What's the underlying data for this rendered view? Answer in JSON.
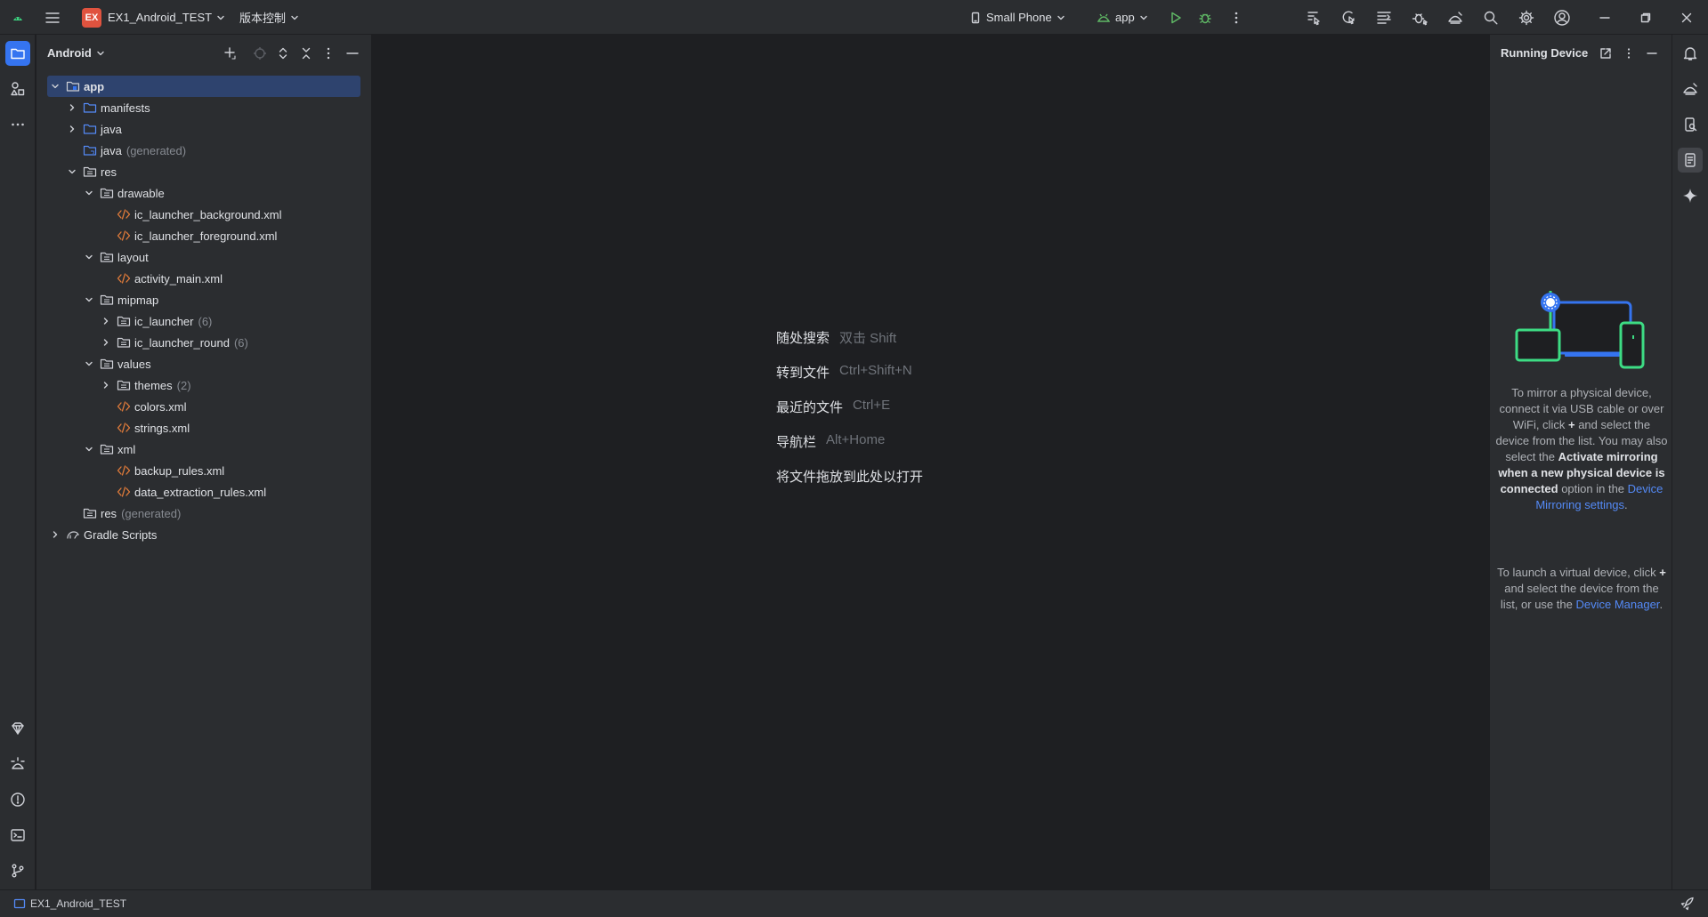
{
  "titlebar": {
    "project_badge": "EX",
    "project_name": "EX1_Android_TEST",
    "vcs_label": "版本控制",
    "device_label": "Small Phone",
    "run_config": "app"
  },
  "project_panel": {
    "view_label": "Android",
    "tree": [
      {
        "label": "app",
        "hint": "",
        "selected": true
      },
      {
        "label": "manifests",
        "hint": ""
      },
      {
        "label": "java",
        "hint": ""
      },
      {
        "label": "java",
        "hint": "(generated)"
      },
      {
        "label": "res",
        "hint": ""
      },
      {
        "label": "drawable",
        "hint": ""
      },
      {
        "label": "ic_launcher_background.xml",
        "hint": ""
      },
      {
        "label": "ic_launcher_foreground.xml",
        "hint": ""
      },
      {
        "label": "layout",
        "hint": ""
      },
      {
        "label": "activity_main.xml",
        "hint": ""
      },
      {
        "label": "mipmap",
        "hint": ""
      },
      {
        "label": "ic_launcher",
        "hint": "(6)"
      },
      {
        "label": "ic_launcher_round",
        "hint": "(6)"
      },
      {
        "label": "values",
        "hint": ""
      },
      {
        "label": "themes",
        "hint": "(2)"
      },
      {
        "label": "colors.xml",
        "hint": ""
      },
      {
        "label": "strings.xml",
        "hint": ""
      },
      {
        "label": "xml",
        "hint": ""
      },
      {
        "label": "backup_rules.xml",
        "hint": ""
      },
      {
        "label": "data_extraction_rules.xml",
        "hint": ""
      },
      {
        "label": "res",
        "hint": "(generated)"
      },
      {
        "label": "Gradle Scripts",
        "hint": ""
      }
    ]
  },
  "editor": {
    "empty_state": [
      {
        "label": "随处搜索",
        "shortcut": "双击 Shift"
      },
      {
        "label": "转到文件",
        "shortcut": "Ctrl+Shift+N"
      },
      {
        "label": "最近的文件",
        "shortcut": "Ctrl+E"
      },
      {
        "label": "导航栏",
        "shortcut": "Alt+Home"
      },
      {
        "label": "将文件拖放到此处以打开",
        "shortcut": ""
      }
    ]
  },
  "running_device": {
    "title": "Running Device",
    "p1_a": "To mirror a physical device, connect it via USB cable or over WiFi, click",
    "p1_b": "and select the device from the list. You may also select the",
    "p1_bold": "Activate mirroring when a new physical device is connected",
    "p1_c": "option in the",
    "p1_link": "Device Mirroring settings",
    "p1_end": ".",
    "p2_a": "To launch a virtual device, click",
    "p2_b": "and select the device from the list, or use the",
    "p2_link": "Device Manager",
    "p2_end": "."
  },
  "statusbar": {
    "project": "EX1_Android_TEST"
  },
  "colors": {
    "accent": "#3574f0",
    "selection": "#2e436e",
    "link": "#548af7",
    "run": "#5fb865",
    "xml_icon": "#e27c3a"
  }
}
